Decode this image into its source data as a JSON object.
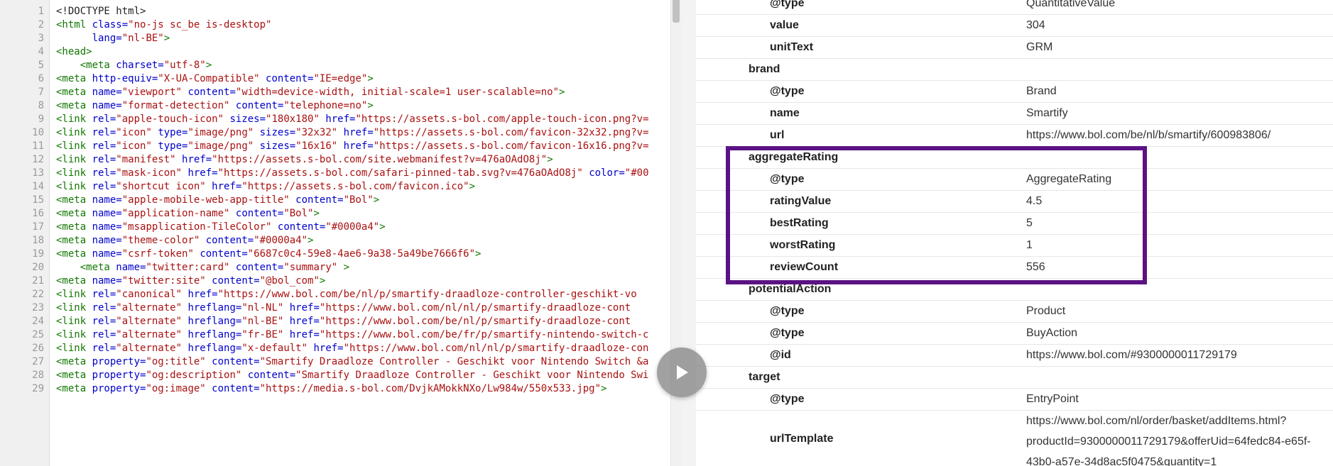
{
  "code_view": {
    "lines": [
      {
        "n": "1",
        "t": [
          [
            "p",
            "<!DOCTYPE html>"
          ]
        ]
      },
      {
        "n": "2",
        "t": [
          [
            "g",
            "<html "
          ],
          [
            "a",
            "class="
          ],
          [
            "s",
            "\"no-js sc_be is-desktop\""
          ]
        ]
      },
      {
        "n": "3",
        "t": [
          [
            "p",
            "      "
          ],
          [
            "a",
            "lang="
          ],
          [
            "s",
            "\"nl-BE\""
          ],
          [
            "g",
            ">"
          ]
        ]
      },
      {
        "n": "4",
        "t": [
          [
            "g",
            "<head>"
          ]
        ]
      },
      {
        "n": "5",
        "t": [
          [
            "p",
            "    "
          ],
          [
            "g",
            "<meta "
          ],
          [
            "a",
            "charset="
          ],
          [
            "s",
            "\"utf-8\""
          ],
          [
            "g",
            ">"
          ]
        ]
      },
      {
        "n": "6",
        "t": [
          [
            "g",
            "<meta "
          ],
          [
            "a",
            "http-equiv="
          ],
          [
            "s",
            "\"X-UA-Compatible\" "
          ],
          [
            "a",
            "content="
          ],
          [
            "s",
            "\"IE=edge\""
          ],
          [
            "g",
            ">"
          ]
        ]
      },
      {
        "n": "7",
        "t": [
          [
            "g",
            "<meta "
          ],
          [
            "a",
            "name="
          ],
          [
            "s",
            "\"viewport\" "
          ],
          [
            "a",
            "content="
          ],
          [
            "s",
            "\"width=device-width, initial-scale=1 user-scalable=no\""
          ],
          [
            "g",
            ">"
          ]
        ]
      },
      {
        "n": "8",
        "t": [
          [
            "g",
            "<meta "
          ],
          [
            "a",
            "name="
          ],
          [
            "s",
            "\"format-detection\" "
          ],
          [
            "a",
            "content="
          ],
          [
            "s",
            "\"telephone=no\""
          ],
          [
            "g",
            ">"
          ]
        ]
      },
      {
        "n": "9",
        "t": [
          [
            "g",
            "<link "
          ],
          [
            "a",
            "rel="
          ],
          [
            "s",
            "\"apple-touch-icon\" "
          ],
          [
            "a",
            "sizes="
          ],
          [
            "s",
            "\"180x180\" "
          ],
          [
            "a",
            "href="
          ],
          [
            "s",
            "\"https://assets.s-bol.com/apple-touch-icon.png?v="
          ]
        ]
      },
      {
        "n": "10",
        "t": [
          [
            "g",
            "<link "
          ],
          [
            "a",
            "rel="
          ],
          [
            "s",
            "\"icon\" "
          ],
          [
            "a",
            "type="
          ],
          [
            "s",
            "\"image/png\" "
          ],
          [
            "a",
            "sizes="
          ],
          [
            "s",
            "\"32x32\" "
          ],
          [
            "a",
            "href="
          ],
          [
            "s",
            "\"https://assets.s-bol.com/favicon-32x32.png?v="
          ]
        ]
      },
      {
        "n": "11",
        "t": [
          [
            "g",
            "<link "
          ],
          [
            "a",
            "rel="
          ],
          [
            "s",
            "\"icon\" "
          ],
          [
            "a",
            "type="
          ],
          [
            "s",
            "\"image/png\" "
          ],
          [
            "a",
            "sizes="
          ],
          [
            "s",
            "\"16x16\" "
          ],
          [
            "a",
            "href="
          ],
          [
            "s",
            "\"https://assets.s-bol.com/favicon-16x16.png?v="
          ]
        ]
      },
      {
        "n": "12",
        "t": [
          [
            "g",
            "<link "
          ],
          [
            "a",
            "rel="
          ],
          [
            "s",
            "\"manifest\" "
          ],
          [
            "a",
            "href="
          ],
          [
            "s",
            "\"https://assets.s-bol.com/site.webmanifest?v=476aOAdO8j\""
          ],
          [
            "g",
            ">"
          ]
        ]
      },
      {
        "n": "13",
        "t": [
          [
            "g",
            "<link "
          ],
          [
            "a",
            "rel="
          ],
          [
            "s",
            "\"mask-icon\" "
          ],
          [
            "a",
            "href="
          ],
          [
            "s",
            "\"https://assets.s-bol.com/safari-pinned-tab.svg?v=476aOAdO8j\" "
          ],
          [
            "a",
            "color="
          ],
          [
            "s",
            "\"#00"
          ]
        ]
      },
      {
        "n": "14",
        "t": [
          [
            "g",
            "<link "
          ],
          [
            "a",
            "rel="
          ],
          [
            "s",
            "\"shortcut icon\" "
          ],
          [
            "a",
            "href="
          ],
          [
            "s",
            "\"https://assets.s-bol.com/favicon.ico\""
          ],
          [
            "g",
            ">"
          ]
        ]
      },
      {
        "n": "15",
        "t": [
          [
            "g",
            "<meta "
          ],
          [
            "a",
            "name="
          ],
          [
            "s",
            "\"apple-mobile-web-app-title\" "
          ],
          [
            "a",
            "content="
          ],
          [
            "s",
            "\"Bol\""
          ],
          [
            "g",
            ">"
          ]
        ]
      },
      {
        "n": "16",
        "t": [
          [
            "g",
            "<meta "
          ],
          [
            "a",
            "name="
          ],
          [
            "s",
            "\"application-name\" "
          ],
          [
            "a",
            "content="
          ],
          [
            "s",
            "\"Bol\""
          ],
          [
            "g",
            ">"
          ]
        ]
      },
      {
        "n": "17",
        "t": [
          [
            "g",
            "<meta "
          ],
          [
            "a",
            "name="
          ],
          [
            "s",
            "\"msapplication-TileColor\" "
          ],
          [
            "a",
            "content="
          ],
          [
            "s",
            "\"#0000a4\""
          ],
          [
            "g",
            ">"
          ]
        ]
      },
      {
        "n": "18",
        "t": [
          [
            "g",
            "<meta "
          ],
          [
            "a",
            "name="
          ],
          [
            "s",
            "\"theme-color\" "
          ],
          [
            "a",
            "content="
          ],
          [
            "s",
            "\"#0000a4\""
          ],
          [
            "g",
            ">"
          ]
        ]
      },
      {
        "n": "19",
        "t": [
          [
            "g",
            "<meta "
          ],
          [
            "a",
            "name="
          ],
          [
            "s",
            "\"csrf-token\" "
          ],
          [
            "a",
            "content="
          ],
          [
            "s",
            "\"6687c0c4-59e8-4ae6-9a38-5a49be7666f6\""
          ],
          [
            "g",
            ">"
          ]
        ]
      },
      {
        "n": "20",
        "t": [
          [
            "p",
            "    "
          ],
          [
            "g",
            "<meta "
          ],
          [
            "a",
            "name="
          ],
          [
            "s",
            "\"twitter:card\" "
          ],
          [
            "a",
            "content="
          ],
          [
            "s",
            "\"summary\" "
          ],
          [
            "g",
            ">"
          ]
        ]
      },
      {
        "n": "21",
        "t": [
          [
            "g",
            "<meta "
          ],
          [
            "a",
            "name="
          ],
          [
            "s",
            "\"twitter:site\" "
          ],
          [
            "a",
            "content="
          ],
          [
            "s",
            "\"@bol_com\""
          ],
          [
            "g",
            ">"
          ]
        ]
      },
      {
        "n": "22",
        "t": [
          [
            "g",
            "<link "
          ],
          [
            "a",
            "rel="
          ],
          [
            "s",
            "\"canonical\" "
          ],
          [
            "a",
            "href="
          ],
          [
            "s",
            "\"https://www.bol.com/be/nl/p/smartify-draadloze-controller-geschikt-vo"
          ]
        ]
      },
      {
        "n": "23",
        "t": [
          [
            "g",
            "<link "
          ],
          [
            "a",
            "rel="
          ],
          [
            "s",
            "\"alternate\" "
          ],
          [
            "a",
            "hreflang="
          ],
          [
            "s",
            "\"nl-NL\" "
          ],
          [
            "a",
            "href="
          ],
          [
            "s",
            "\"https://www.bol.com/nl/nl/p/smartify-draadloze-cont"
          ]
        ]
      },
      {
        "n": "24",
        "t": [
          [
            "g",
            "<link "
          ],
          [
            "a",
            "rel="
          ],
          [
            "s",
            "\"alternate\" "
          ],
          [
            "a",
            "hreflang="
          ],
          [
            "s",
            "\"nl-BE\" "
          ],
          [
            "a",
            "href="
          ],
          [
            "s",
            "\"https://www.bol.com/be/nl/p/smartify-draadloze-cont"
          ]
        ]
      },
      {
        "n": "25",
        "t": [
          [
            "g",
            "<link "
          ],
          [
            "a",
            "rel="
          ],
          [
            "s",
            "\"alternate\" "
          ],
          [
            "a",
            "hreflang="
          ],
          [
            "s",
            "\"fr-BE\" "
          ],
          [
            "a",
            "href="
          ],
          [
            "s",
            "\"https://www.bol.com/be/fr/p/smartify-nintendo-switch-c"
          ]
        ]
      },
      {
        "n": "26",
        "t": [
          [
            "g",
            "<link "
          ],
          [
            "a",
            "rel="
          ],
          [
            "s",
            "\"alternate\" "
          ],
          [
            "a",
            "hreflang="
          ],
          [
            "s",
            "\"x-default\" "
          ],
          [
            "a",
            "href="
          ],
          [
            "s",
            "\"https://www.bol.com/nl/nl/p/smartify-draadloze-con"
          ]
        ]
      },
      {
        "n": "27",
        "t": [
          [
            "g",
            "<meta "
          ],
          [
            "a",
            "property="
          ],
          [
            "s",
            "\"og:title\" "
          ],
          [
            "a",
            "content="
          ],
          [
            "s",
            "\"Smartify Draadloze Controller - Geschikt voor Nintendo Switch &a"
          ]
        ]
      },
      {
        "n": "28",
        "t": [
          [
            "g",
            "<meta "
          ],
          [
            "a",
            "property="
          ],
          [
            "s",
            "\"og:description\" "
          ],
          [
            "a",
            "content="
          ],
          [
            "s",
            "\"Smartify Draadloze Controller - Geschikt voor Nintendo Swi"
          ]
        ]
      },
      {
        "n": "29",
        "t": [
          [
            "g",
            "<meta "
          ],
          [
            "a",
            "property="
          ],
          [
            "s",
            "\"og:image\" "
          ],
          [
            "a",
            "content="
          ],
          [
            "s",
            "\"https://media.s-bol.com/DvjkAMokkNXo/Lw984w/550x533.jpg\""
          ],
          [
            "g",
            ">"
          ]
        ]
      }
    ]
  },
  "structured_data": {
    "rows": [
      {
        "key": "@type",
        "value": "QuantitativeValue",
        "level": 2
      },
      {
        "key": "value",
        "value": "304",
        "level": 2
      },
      {
        "key": "unitText",
        "value": "GRM",
        "level": 2
      },
      {
        "key": "brand",
        "value": "",
        "level": 1
      },
      {
        "key": "@type",
        "value": "Brand",
        "level": 2
      },
      {
        "key": "name",
        "value": "Smartify",
        "level": 2
      },
      {
        "key": "url",
        "value": "https://www.bol.com/be/nl/b/smartify/600983806/",
        "level": 2
      },
      {
        "key": "aggregateRating",
        "value": "",
        "level": 1
      },
      {
        "key": "@type",
        "value": "AggregateRating",
        "level": 2
      },
      {
        "key": "ratingValue",
        "value": "4.5",
        "level": 2
      },
      {
        "key": "bestRating",
        "value": "5",
        "level": 2
      },
      {
        "key": "worstRating",
        "value": "1",
        "level": 2
      },
      {
        "key": "reviewCount",
        "value": "556",
        "level": 2
      },
      {
        "key": "potentialAction",
        "value": "",
        "level": 1
      },
      {
        "key": "@type",
        "value": "Product",
        "level": 2
      },
      {
        "key": "@type",
        "value": "BuyAction",
        "level": 2
      },
      {
        "key": "@id",
        "value": "https://www.bol.com/#9300000011729179",
        "level": 2
      },
      {
        "key": "target",
        "value": "",
        "level": 1
      },
      {
        "key": "@type",
        "value": "EntryPoint",
        "level": 2
      },
      {
        "key": "urlTemplate",
        "value": "https://www.bol.com/nl/order/basket/addItems.html?productId=9300000011729179&offerUid=64fedc84-e65f-43b0-a57e-34d8ac5f0475&quantity=1",
        "level": 2,
        "tall": true
      }
    ]
  },
  "colors": {
    "highlight": "#5b1384",
    "code_tag": "#117700",
    "code_attr": "#0000cc",
    "code_string": "#aa1111"
  },
  "icons": {
    "overlay": "play-icon"
  }
}
